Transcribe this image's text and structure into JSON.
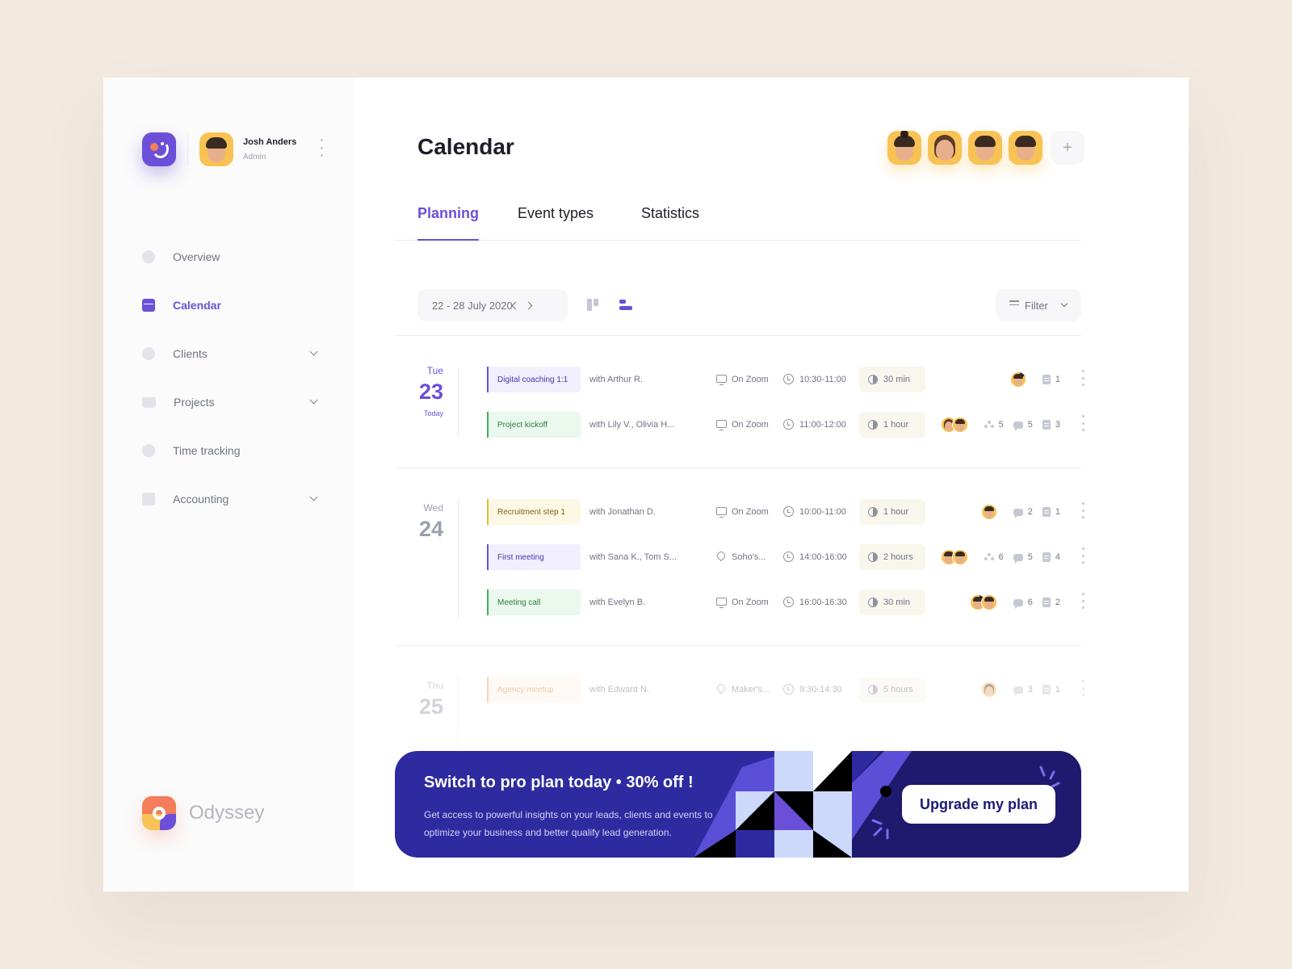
{
  "user": {
    "name": "Josh Anders",
    "role": "Admin"
  },
  "nav": [
    {
      "label": "Overview",
      "icon": "overview-icon",
      "active": false,
      "expandable": false
    },
    {
      "label": "Calendar",
      "icon": "calendar-icon",
      "active": true,
      "expandable": false
    },
    {
      "label": "Clients",
      "icon": "clients-icon",
      "active": false,
      "expandable": true
    },
    {
      "label": "Projects",
      "icon": "folder-icon",
      "active": false,
      "expandable": true
    },
    {
      "label": "Time tracking",
      "icon": "check-circle-icon",
      "active": false,
      "expandable": false
    },
    {
      "label": "Accounting",
      "icon": "calculator-icon",
      "active": false,
      "expandable": true
    }
  ],
  "brand": {
    "name": "Odyssey"
  },
  "header": {
    "title": "Calendar",
    "add_label": "+"
  },
  "tabs": [
    {
      "label": "Planning",
      "active": true
    },
    {
      "label": "Event types",
      "active": false
    },
    {
      "label": "Statistics",
      "active": false
    }
  ],
  "toolbar": {
    "date_range": "22 - 28 July 2020",
    "filter_label": "Filter"
  },
  "colors": {
    "accent": "#6b4fd8",
    "promo_bg": "#2e2aa0",
    "avatar_bg": "#f8c255",
    "page_bg": "#f2e9df"
  },
  "days": [
    {
      "dow": "Tue",
      "num": "23",
      "note": "Today",
      "events": [
        {
          "title": "Digital coaching 1:1",
          "tag": "purple",
          "with": "with Arthur R.",
          "loc_icon": "screen",
          "location": "On Zoom",
          "time": "10:30-11:00",
          "duration": "30 min",
          "avatars": 1,
          "people": "",
          "comments": "",
          "docs": "1"
        },
        {
          "title": "Project kickoff",
          "tag": "green",
          "with": "with Lily V., Olivia H...",
          "loc_icon": "screen",
          "location": "On Zoom",
          "time": "11:00-12:00",
          "duration": "1 hour",
          "avatars": 2,
          "people": "5",
          "comments": "5",
          "docs": "3"
        }
      ]
    },
    {
      "dow": "Wed",
      "num": "24",
      "note": "",
      "events": [
        {
          "title": "Recruitment step 1",
          "tag": "yellow",
          "with": "with Jonathan D.",
          "loc_icon": "screen",
          "location": "On Zoom",
          "time": "10:00-11:00",
          "duration": "1 hour",
          "avatars": 1,
          "people": "",
          "comments": "2",
          "docs": "1"
        },
        {
          "title": "First meeting",
          "tag": "purple",
          "with": "with Sana K., Tom S...",
          "loc_icon": "pin",
          "location": "Soho's...",
          "time": "14:00-16:00",
          "duration": "2 hours",
          "avatars": 2,
          "people": "6",
          "comments": "5",
          "docs": "4"
        },
        {
          "title": "Meeting call",
          "tag": "green",
          "with": "with Evelyn B.",
          "loc_icon": "screen",
          "location": "On Zoom",
          "time": "16:00-16:30",
          "duration": "30 min",
          "avatars": 2,
          "people": "",
          "comments": "6",
          "docs": "2"
        }
      ]
    },
    {
      "dow": "Thu",
      "num": "25",
      "note": "",
      "events": [
        {
          "title": "Agency meetup",
          "tag": "orange",
          "with": "with Edward N.",
          "loc_icon": "pin",
          "location": "Maker's...",
          "time": "9:30-14:30",
          "duration": "5 hours",
          "avatars": 1,
          "people": "",
          "comments": "3",
          "docs": "1"
        }
      ]
    }
  ],
  "promo": {
    "title": "Switch to pro plan today • 30% off !",
    "text": "Get access to powerful insights on your leads, clients and events to optimize your business and better qualify lead generation.",
    "button": "Upgrade my plan"
  }
}
